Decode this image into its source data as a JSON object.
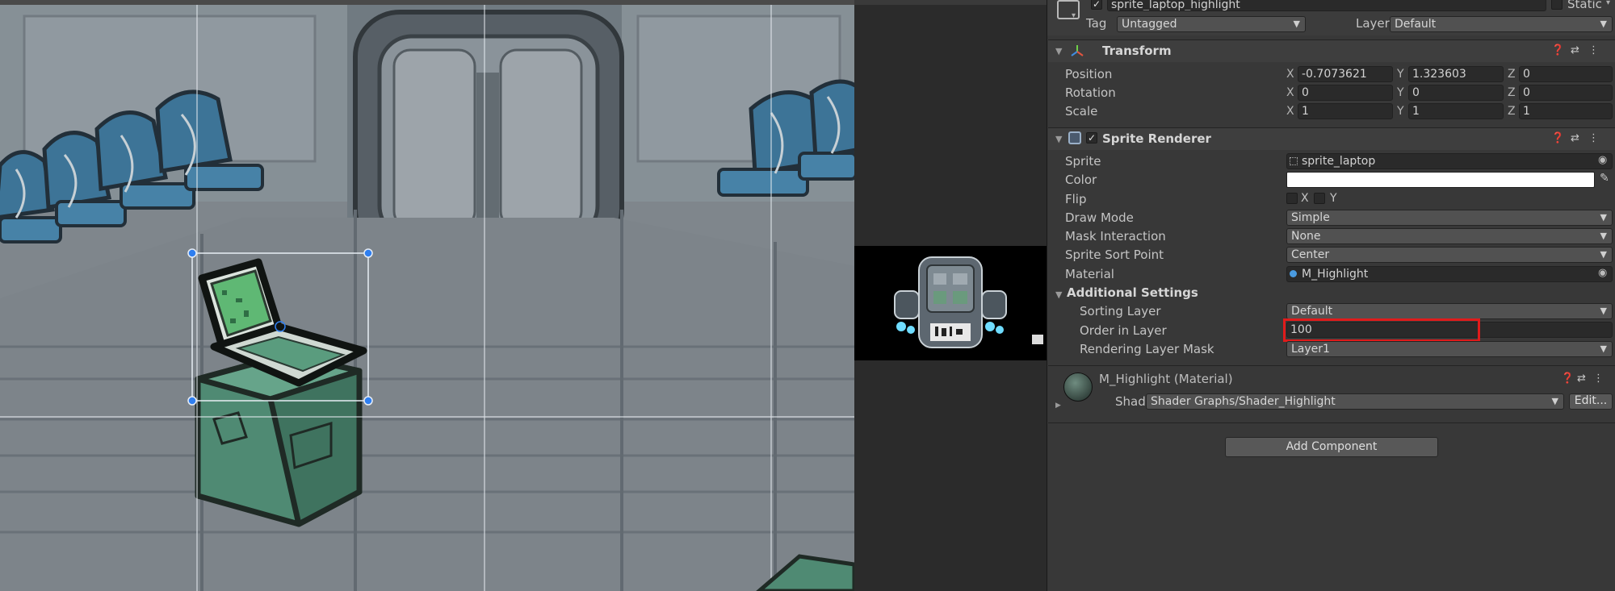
{
  "object": {
    "name": "sprite_laptop_highlight",
    "static_label": "Static",
    "tag_label": "Tag",
    "tag_value": "Untagged",
    "layer_label": "Layer",
    "layer_value": "Default"
  },
  "transform": {
    "title": "Transform",
    "rows": [
      {
        "label": "Position",
        "x": "-0.7073621",
        "y": "1.323603",
        "z": "0"
      },
      {
        "label": "Rotation",
        "x": "0",
        "y": "0",
        "z": "0"
      },
      {
        "label": "Scale",
        "x": "1",
        "y": "1",
        "z": "1"
      }
    ],
    "axis_x": "X",
    "axis_y": "Y",
    "axis_z": "Z"
  },
  "sprite_renderer": {
    "title": "Sprite Renderer",
    "sprite_label": "Sprite",
    "sprite_value": "sprite_laptop",
    "color_label": "Color",
    "color_value": "#ffffff",
    "flip_label": "Flip",
    "flip_x": "X",
    "flip_y": "Y",
    "draw_mode_label": "Draw Mode",
    "draw_mode_value": "Simple",
    "mask_label": "Mask Interaction",
    "mask_value": "None",
    "sort_point_label": "Sprite Sort Point",
    "sort_point_value": "Center",
    "material_label": "Material",
    "material_value": "M_Highlight",
    "additional_label": "Additional Settings",
    "sorting_layer_label": "Sorting Layer",
    "sorting_layer_value": "Default",
    "order_label": "Order in Layer",
    "order_value": "100",
    "rendering_mask_label": "Rendering Layer Mask",
    "rendering_mask_value": "Layer1"
  },
  "material": {
    "title": "M_Highlight (Material)",
    "shader_label": "Shader",
    "shader_value": "Shader Graphs/Shader_Highlight",
    "edit_label": "Edit..."
  },
  "add_component_label": "Add Component",
  "colors": {
    "highlight_box": "#e01b1b",
    "inspector_bg": "#383838",
    "selection_handle": "#2f7ff0"
  }
}
